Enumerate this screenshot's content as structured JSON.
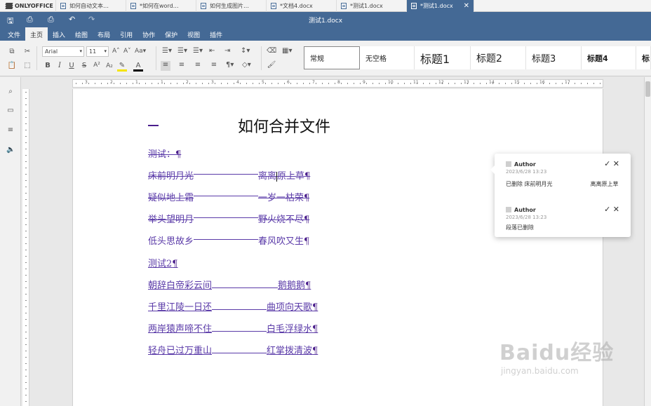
{
  "tabs": {
    "logo": "ONLYOFFICE",
    "items": [
      {
        "label": "如何自动文本…"
      },
      {
        "label": "*如何在word…"
      },
      {
        "label": "如何生成图片…"
      },
      {
        "label": "*文档4.docx"
      },
      {
        "label": "*测试1.docx"
      },
      {
        "label": "*测试1.docx",
        "close": "✕"
      }
    ]
  },
  "header": {
    "title": "测试1.docx"
  },
  "menu": [
    "文件",
    "主页",
    "插入",
    "绘图",
    "布局",
    "引用",
    "协作",
    "保护",
    "视图",
    "插件"
  ],
  "toolbar": {
    "font_name": "Arial",
    "font_size": "11",
    "styles": [
      "常规",
      "无空格",
      "标题1",
      "标题2",
      "标题3",
      "标题4",
      "标"
    ]
  },
  "ruler_numbers": [
    "3",
    "2",
    "1",
    "1",
    "2",
    "3",
    "4",
    "5",
    "6",
    "7",
    "8",
    "9",
    "10",
    "11",
    "12",
    "13",
    "14",
    "15",
    "16",
    "17"
  ],
  "document": {
    "dash": "—",
    "title": "如何合并文件",
    "lines": [
      {
        "type": "del",
        "a": "测试：",
        "pm": "¶"
      },
      {
        "type": "del",
        "a": "床前明月光",
        "b": "离离",
        "c": "原上草",
        "pm": "¶"
      },
      {
        "type": "del",
        "a": "疑似地上霜",
        "b": "一岁一枯荣",
        "pm": "¶"
      },
      {
        "type": "del",
        "a": "举头望明月",
        "b": "野火烧不尽",
        "pm": "¶"
      },
      {
        "type": "del",
        "a": "低头思故乡",
        "b": "春风吹又生",
        "pm": "¶"
      },
      {
        "type": "ins",
        "a": "测试2",
        "pm": "¶"
      },
      {
        "type": "ins",
        "a": "朝辞白帝彩云间",
        "b": "鹅鹅鹅",
        "pm": "¶"
      },
      {
        "type": "ins",
        "a": "千里江陵一日还",
        "b": "曲项向天歌",
        "pm": "¶"
      },
      {
        "type": "ins",
        "a": "两岸猿声啼不住",
        "b": "白毛浮绿水",
        "pm": "¶"
      },
      {
        "type": "ins",
        "a": "轻舟已过万重山",
        "b": "红掌拨清波",
        "pm": "¶"
      }
    ]
  },
  "comments": [
    {
      "author": "Author",
      "date": "2023/6/28 13:23",
      "body_prefix": "已删除 ",
      "body_text": "床前明月光",
      "body_tail": "离离原上草"
    },
    {
      "author": "Author",
      "date": "2023/6/28 13:23",
      "body_text": "段落已删除"
    }
  ],
  "watermark": {
    "big": "Baidu经验",
    "small": "jingyan.baidu.com"
  }
}
